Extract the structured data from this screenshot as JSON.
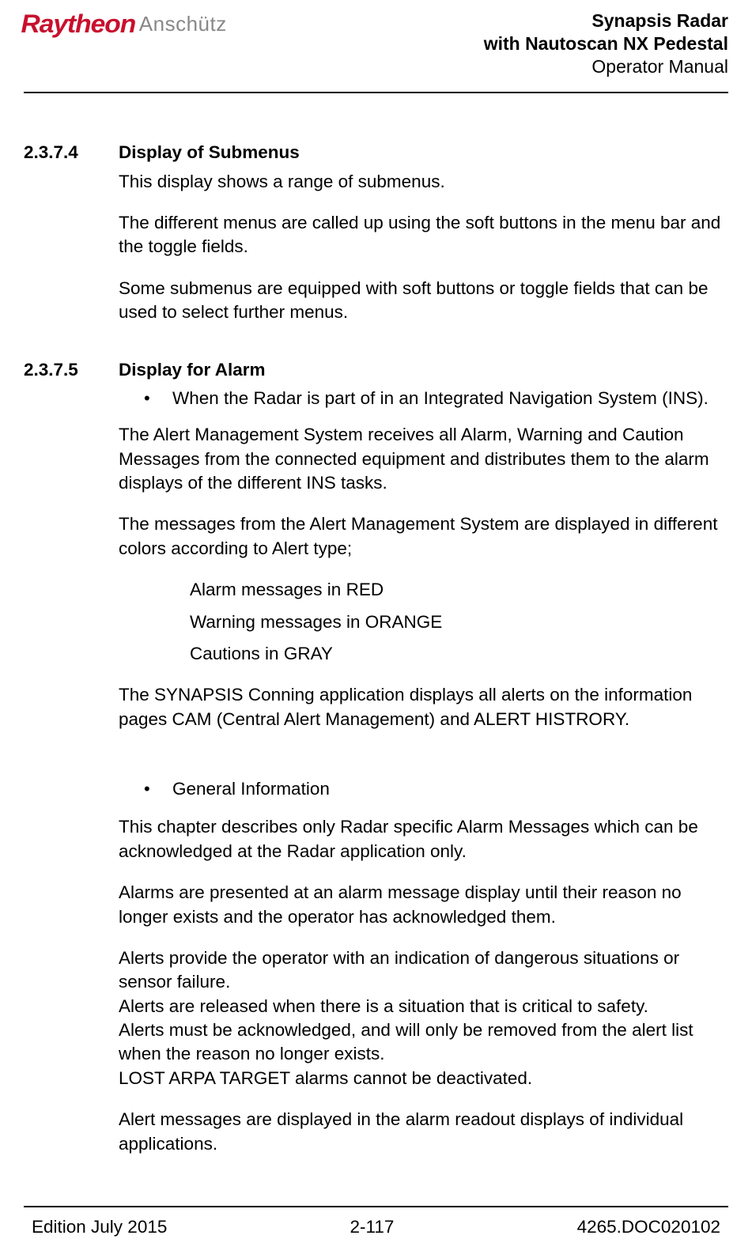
{
  "header": {
    "logo_primary": "Raytheon",
    "logo_secondary": "Anschütz",
    "title_line1": "Synapsis Radar",
    "title_line2": "with Nautoscan NX Pedestal",
    "title_line3": "Operator Manual"
  },
  "sections": {
    "s1": {
      "number": "2.3.7.4",
      "title": "Display of Submenus",
      "p1": "This display shows a range of submenus.",
      "p2": "The different menus are called up using the soft buttons in the menu bar and the toggle fields.",
      "p3": "Some submenus are equipped with soft buttons or toggle fields that can be used to select further menus."
    },
    "s2": {
      "number": "2.3.7.5",
      "title": "Display for Alarm",
      "bullet1": "When the Radar is part of in an Integrated Navigation System (INS).",
      "p1": "The Alert Management System receives all Alarm, Warning and Caution Messages from the connected equipment and distributes them to the alarm displays of the different INS tasks.",
      "p2": "The messages from the Alert Management System are displayed in different colors according to Alert type;",
      "color_list": {
        "i1": "Alarm messages in RED",
        "i2": "Warning messages in ORANGE",
        "i3": "Cautions in GRAY"
      },
      "p3": "The SYNAPSIS Conning application displays all alerts on the information pages CAM (Central Alert Management) and ALERT HISTRORY.",
      "bullet2": "General Information",
      "p4": "This chapter describes only Radar specific Alarm Messages which can be acknowledged at the Radar application only.",
      "p5": "Alarms are presented at an alarm message display until their reason no longer exists and the operator has acknowledged them.",
      "p6": "Alerts provide the operator with an indication of dangerous situations or sensor failure.\nAlerts are released when there is a situation that is critical to safety.\nAlerts must be acknowledged, and will only be removed from the alert list when the reason no longer exists.\nLOST ARPA TARGET alarms cannot be deactivated.",
      "p7": "Alert messages are displayed in the alarm readout displays of individual applications."
    }
  },
  "footer": {
    "left": "Edition July 2015",
    "center": "2-117",
    "right": "4265.DOC020102"
  }
}
